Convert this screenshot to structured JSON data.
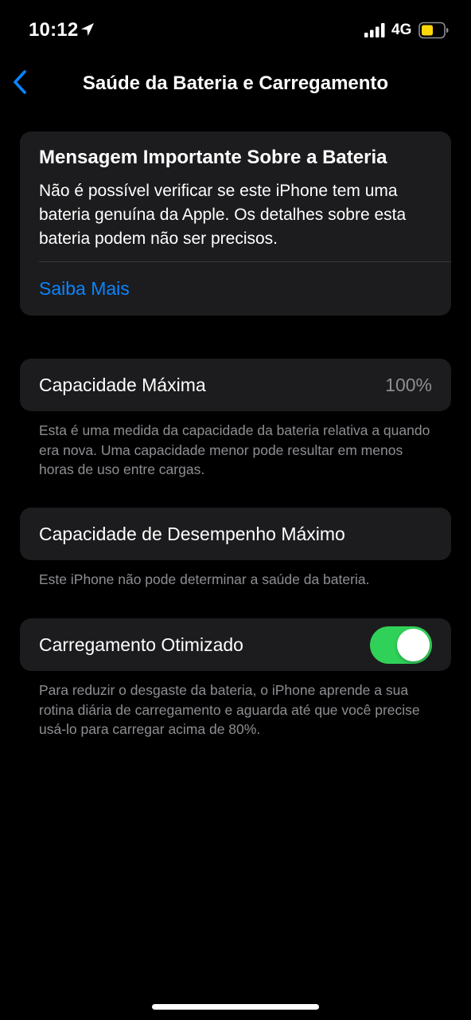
{
  "status_bar": {
    "time": "10:12",
    "network": "4G",
    "location_icon": "location-arrow-icon",
    "signal_icon": "cellular-signal-icon",
    "battery_icon": "battery-low-power-icon",
    "battery_fill_color": "#ffd60a"
  },
  "nav": {
    "back_icon": "chevron-left-icon",
    "title": "Saúde da Bateria e Carregamento"
  },
  "message_card": {
    "title": "Mensagem Importante Sobre a Bateria",
    "body": "Não é possível verificar se este iPhone tem uma bateria genuína da Apple. Os detalhes sobre esta bateria podem não ser precisos.",
    "link_label": "Saiba Mais"
  },
  "capacity": {
    "label": "Capacidade Máxima",
    "value": "100%",
    "footnote": "Esta é uma medida da capacidade da bateria relativa a quando era nova. Uma capacidade menor pode resultar em menos horas de uso entre cargas."
  },
  "performance": {
    "label": "Capacidade de Desempenho Máximo",
    "footnote": "Este iPhone não pode determinar a saúde da bateria."
  },
  "optimized_charging": {
    "label": "Carregamento Otimizado",
    "enabled": true,
    "footnote": "Para reduzir o desgaste da bateria, o iPhone aprende a sua rotina diária de carregamento e aguarda até que você precise usá-lo para carregar acima de 80%."
  },
  "colors": {
    "accent": "#0a84ff",
    "toggle_on": "#30d158",
    "card_bg": "#1c1c1e",
    "secondary_text": "#8e8e93"
  }
}
